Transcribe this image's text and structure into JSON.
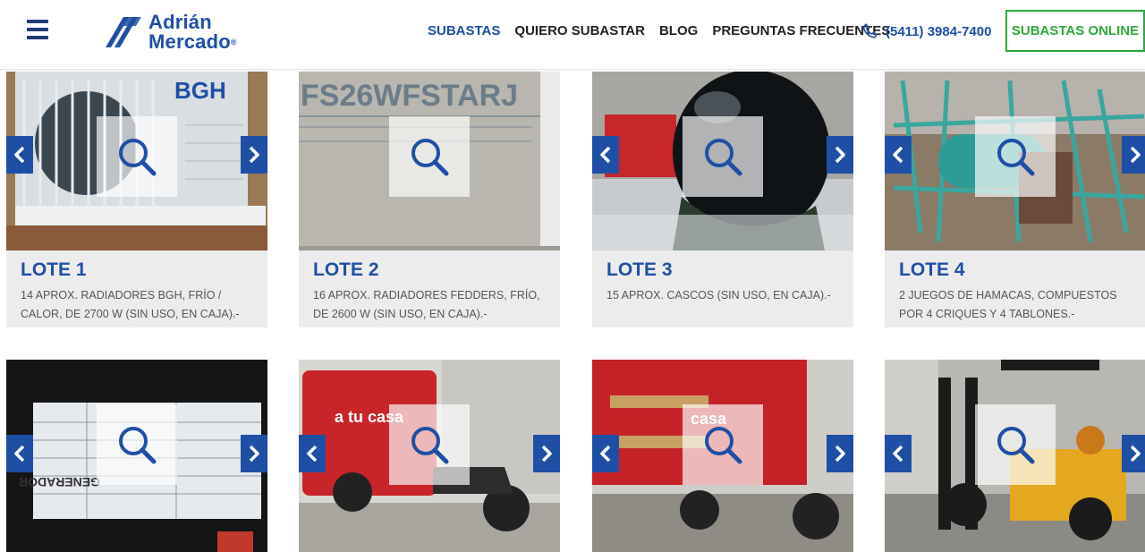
{
  "header": {
    "logo_line1": "Adrián",
    "logo_line2": "Mercado",
    "logo_reg": "®",
    "nav": [
      "SUBASTAS",
      "QUIERO SUBASTAR",
      "BLOG",
      "PREGUNTAS FRECUENTES"
    ],
    "phone": "(5411) 3984-7400",
    "online_button": "SUBASTAS ONLINE"
  },
  "icons": {
    "menu": "hamburger-icon",
    "phone": "phone-icon",
    "zoom": "search-icon",
    "prev": "chevron-left-icon",
    "next": "chevron-right-icon"
  },
  "colors": {
    "brand": "#1f4fa5",
    "green": "#2eaa3a"
  },
  "lots": [
    {
      "title": "LOTE 1",
      "desc": "14 APROX. RADIADORES BGH, FRÍO / CALOR, DE 2700 W (SIN USO, EN CAJA).-",
      "image_text": "BGH"
    },
    {
      "title": "LOTE 2",
      "desc": "16 APROX. RADIADORES FEDDERS, FRÍO, DE 2600 W (SIN USO, EN CAJA).-",
      "image_text": "FS26WFSTARJ"
    },
    {
      "title": "LOTE 3",
      "desc": "15 APROX. CASCOS (SIN USO, EN CAJA).-"
    },
    {
      "title": "LOTE 4",
      "desc": "2 JUEGOS DE HAMACAS, COMPUESTOS POR 4 CRIQUES Y 4 TABLONES.-"
    },
    {
      "image_text": "GENERADOR"
    },
    {
      "image_text": "a tu casa"
    },
    {
      "image_text": "casa"
    },
    {}
  ]
}
